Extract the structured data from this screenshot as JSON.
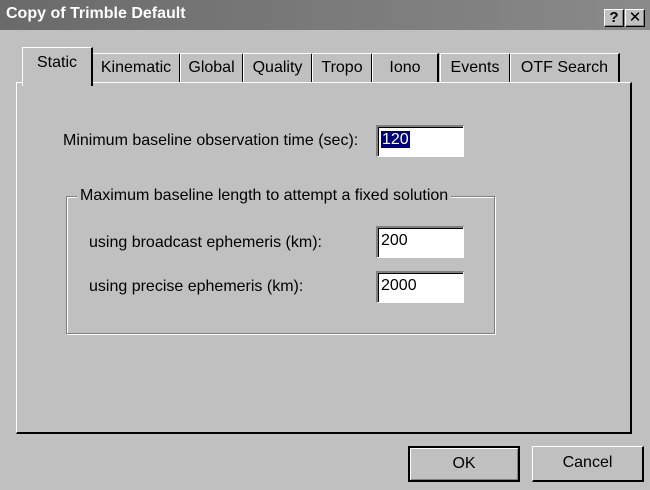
{
  "window": {
    "title": "Copy of Trimble Default",
    "help_glyph": "?",
    "close_glyph": "✕"
  },
  "tabs": [
    {
      "label": "Static",
      "active": true
    },
    {
      "label": "Kinematic"
    },
    {
      "label": "Global"
    },
    {
      "label": "Quality"
    },
    {
      "label": "Tropo"
    },
    {
      "label": "Iono"
    },
    {
      "label": "Events"
    },
    {
      "label": "OTF Search"
    }
  ],
  "static": {
    "min_obs_label": "Minimum baseline observation time (sec):",
    "min_obs_value": "120",
    "group_title": "Maximum baseline length to attempt a fixed solution",
    "broadcast_label": "using broadcast ephemeris (km):",
    "broadcast_value": "200",
    "precise_label": "using precise ephemeris (km):",
    "precise_value": "2000"
  },
  "buttons": {
    "ok": "OK",
    "cancel": "Cancel"
  }
}
